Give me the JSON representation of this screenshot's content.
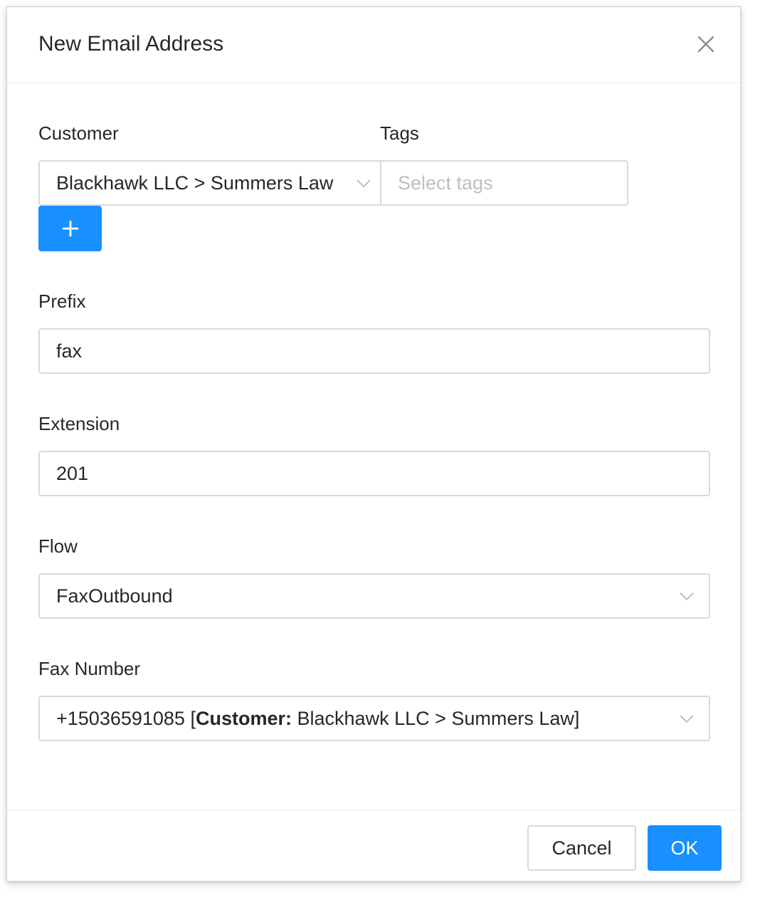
{
  "dialog": {
    "title": "New Email Address",
    "close_icon": "close-icon"
  },
  "form": {
    "customer": {
      "label": "Customer",
      "value": "Blackhawk LLC > Summers Law",
      "icon": "chevron-down-icon"
    },
    "tags": {
      "label": "Tags",
      "placeholder": "Select tags"
    },
    "add_customer": {
      "icon": "plus-icon"
    },
    "prefix": {
      "label": "Prefix",
      "value": "fax"
    },
    "extension": {
      "label": "Extension",
      "value": "201"
    },
    "flow": {
      "label": "Flow",
      "value": "FaxOutbound",
      "icon": "chevron-down-icon"
    },
    "fax_number": {
      "label": "Fax Number",
      "number": "+15036591085",
      "open_bracket": "[",
      "customer_key": "Customer:",
      "customer_value": "Blackhawk LLC > Summers Law",
      "close_bracket": "]",
      "icon": "chevron-down-icon"
    }
  },
  "footer": {
    "cancel_label": "Cancel",
    "ok_label": "OK"
  },
  "colors": {
    "primary": "#1890ff",
    "border": "#d9d9d9",
    "placeholder": "#bfbfbf"
  }
}
